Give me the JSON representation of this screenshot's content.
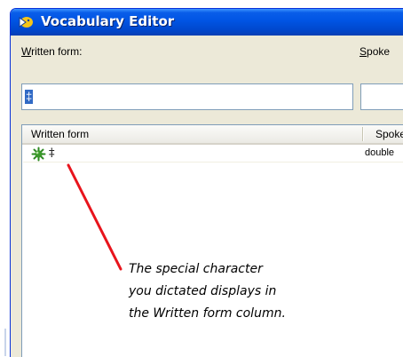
{
  "window": {
    "title": "Vocabulary Editor",
    "icon": "vocabulary-editor-icon"
  },
  "form": {
    "written_label": "Written form:",
    "written_accesskey": "W",
    "written_rest": "ritten form:",
    "spoken_label": "Spoke",
    "spoken_accesskey": "S",
    "spoken_rest": "poke",
    "written_value": "‡",
    "spoken_value": ""
  },
  "list": {
    "columns": [
      "Written form",
      "Spoke"
    ],
    "rows": [
      {
        "icon": "custom-word-icon",
        "written": "‡",
        "spoken": "double"
      }
    ]
  },
  "annotation": {
    "lines": [
      "The special character",
      "you dictated displays in",
      "the Written form column."
    ],
    "line_color": "#e8141c"
  }
}
